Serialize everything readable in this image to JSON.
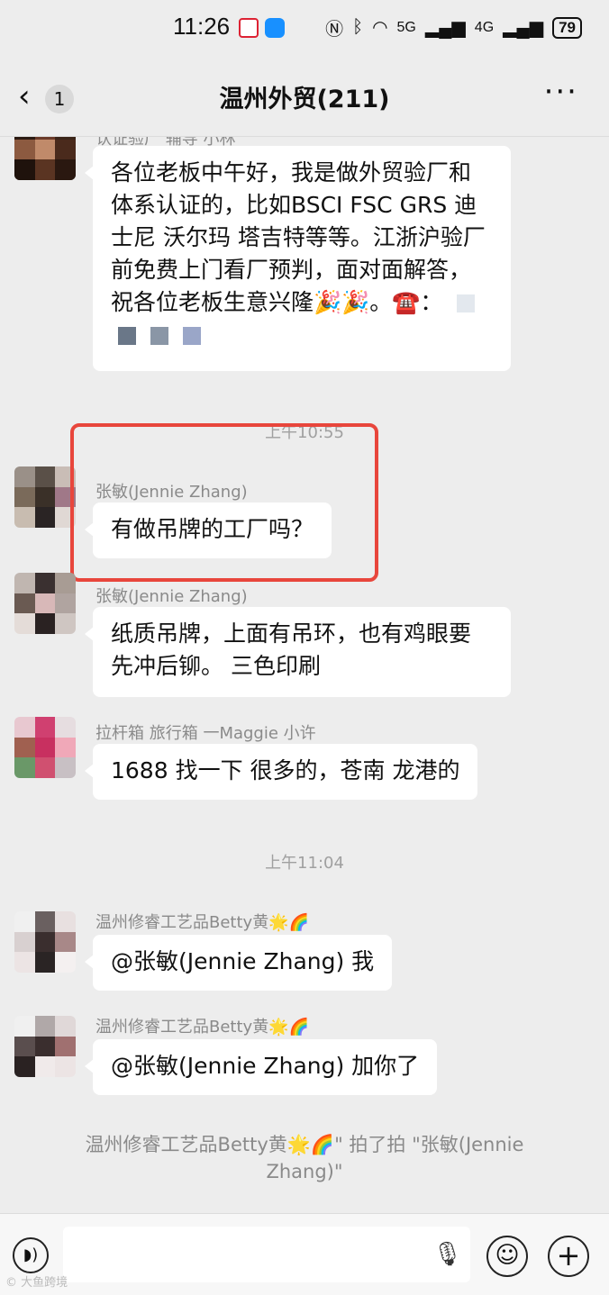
{
  "status_bar": {
    "time": "11:26",
    "network_5g": "5G",
    "network_4g": "4G",
    "battery": "79"
  },
  "header": {
    "back_count": "1",
    "title": "温州外贸(211)"
  },
  "messages": [
    {
      "sender": "认证验厂 辅导 小林",
      "text": "各位老板中午好，我是做外贸验厂和体系认证的，比如BSCI FSC GRS 迪士尼 沃尔玛 塔吉特等等。江浙沪验厂前免费上门看厂预判，面对面解答，祝各位老板生意兴隆🎉🎉。☎️："
    },
    {
      "time": "上午10:55"
    },
    {
      "sender": "张敏(Jennie Zhang)",
      "text": "有做吊牌的工厂吗？"
    },
    {
      "sender": "张敏(Jennie Zhang)",
      "text": "纸质吊牌，上面有吊环，也有鸡眼要先冲后铆。 三色印刷"
    },
    {
      "sender": "拉杆箱 旅行箱 一Maggie 小许",
      "text": "1688 找一下 很多的，苍南 龙港的"
    },
    {
      "time": "上午11:04"
    },
    {
      "sender": "温州修睿工艺品Betty黄🌟🌈",
      "text": "@张敏(Jennie Zhang) 我"
    },
    {
      "sender": "温州修睿工艺品Betty黄🌟🌈",
      "text": "@张敏(Jennie Zhang) 加你了"
    },
    {
      "system": "温州修睿工艺品Betty黄🌟🌈\" 拍了拍 \"张敏(Jennie Zhang)\""
    }
  ],
  "watermark": "© 大鱼跨境",
  "colors": {
    "background": "#ededed",
    "bubble": "#ffffff",
    "highlight": "#e8463c"
  }
}
